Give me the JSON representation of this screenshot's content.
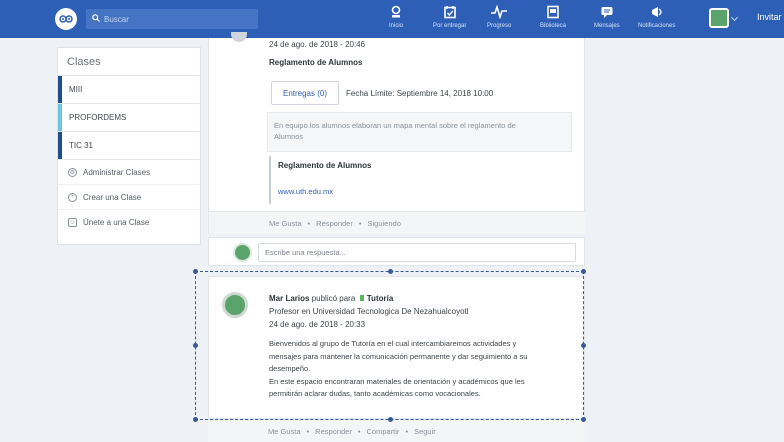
{
  "topbar": {
    "search_placeholder": "Buscar",
    "nav": [
      {
        "label": "Inicio",
        "icon": "home-icon"
      },
      {
        "label": "Por entregar",
        "icon": "calendar-check-icon"
      },
      {
        "label": "Progreso",
        "icon": "pulse-icon"
      },
      {
        "label": "Biblioteca",
        "icon": "backpack-icon"
      },
      {
        "label": "Mensajes",
        "icon": "chat-icon"
      },
      {
        "label": "Notificaciones",
        "icon": "megaphone-icon"
      }
    ],
    "invite_label": "Invitar"
  },
  "sidebar": {
    "title": "Clases",
    "classes": [
      {
        "name": "MIII",
        "color": "#1f4e8c"
      },
      {
        "name": "PROFORDEMS",
        "color": "#6cc3e6"
      },
      {
        "name": "TIC 31",
        "color": "#1f4e8c"
      }
    ],
    "actions": [
      {
        "label": "Administrar Clases",
        "icon": "gear-icon"
      },
      {
        "label": "Crear una Clase",
        "icon": "plus-circle-icon"
      },
      {
        "label": "Únete a una Clase",
        "icon": "people-icon"
      }
    ]
  },
  "post1": {
    "timestamp": "24 de ago. de 2018 - 20:46",
    "title": "Reglamento de Alumnos",
    "entregas_label": "Entregas (0)",
    "deadline": "Fecha Límite: Septiembre 14, 2018 10:00",
    "description_line1": "En equipo los alumnos elaboran un mapa mental sobre el reglamento de",
    "description_line2": "Alumnos",
    "attachment_title": "Reglamento de Alumnos",
    "attachment_link": "www.uth.edu.mx",
    "footer": [
      "Me Gusta",
      "Responder",
      "Siguiendo"
    ]
  },
  "reply": {
    "placeholder": "Escribe una respuesta..."
  },
  "post2": {
    "author": "Mar Larios",
    "published_for": "publicó para",
    "group": "Tutoría",
    "group_color": "#5cb85c",
    "subtitle": "Profesor en Universidad Tecnologica De Nezahualcoyotl",
    "timestamp": "24 de ago. de 2018 - 20:33",
    "body": [
      "Bienvenidos al grupo de Tutoría en el cual intercambiaremos actividades y",
      "mensajes para mantener la comunicación permanente y dar seguimiento a su",
      "desempeño.",
      "En este espacio encontraran materiales de orientación y académicos que les",
      "permitirán aclarar dudas, tanto académicas como vocacionales."
    ],
    "footer": [
      "Me Gusta",
      "Responder",
      "Compartir",
      "Seguir"
    ]
  },
  "colors": {
    "nav_bg": "#2d5fb7",
    "page_bg": "#eef1f6",
    "link": "#2d5fb7",
    "selection": "#3b5a93"
  }
}
